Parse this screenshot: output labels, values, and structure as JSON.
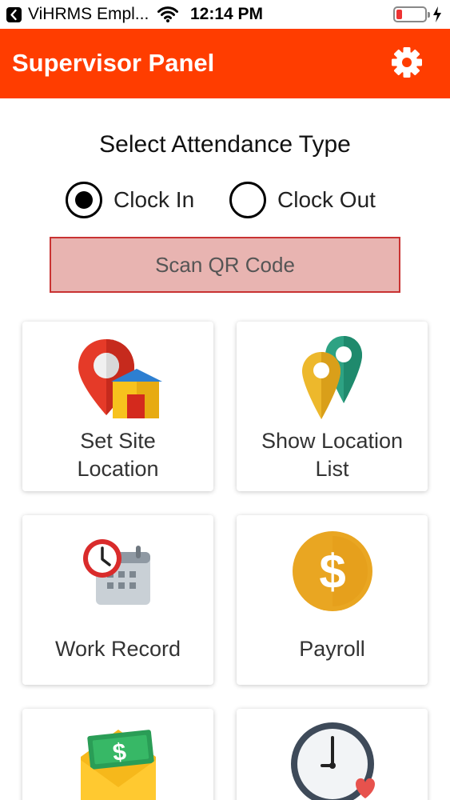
{
  "status_bar": {
    "app_name": "ViHRMS Empl...",
    "time": "12:14 PM"
  },
  "header": {
    "title": "Supervisor Panel",
    "settings_icon": "gear-icon"
  },
  "attendance": {
    "title": "Select Attendance Type",
    "options": [
      {
        "label": "Clock In",
        "selected": true
      },
      {
        "label": "Clock Out",
        "selected": false
      }
    ],
    "scan_button": "Scan QR Code"
  },
  "menu": [
    {
      "label_line1": "Set Site",
      "label_line2": "Location",
      "icon": "map-pin-house-icon"
    },
    {
      "label_line1": "Show Location",
      "label_line2": "List",
      "icon": "location-pins-icon"
    },
    {
      "label": "Work Record",
      "icon": "clock-calendar-icon"
    },
    {
      "label": "Payroll",
      "icon": "dollar-coin-icon"
    },
    {
      "label": "",
      "icon": "money-envelope-icon"
    },
    {
      "label": "",
      "icon": "clock-heart-icon"
    }
  ],
  "colors": {
    "primary": "#ff3d00",
    "scan_button_bg": "#e8b4b1",
    "scan_button_border": "#c93333"
  }
}
